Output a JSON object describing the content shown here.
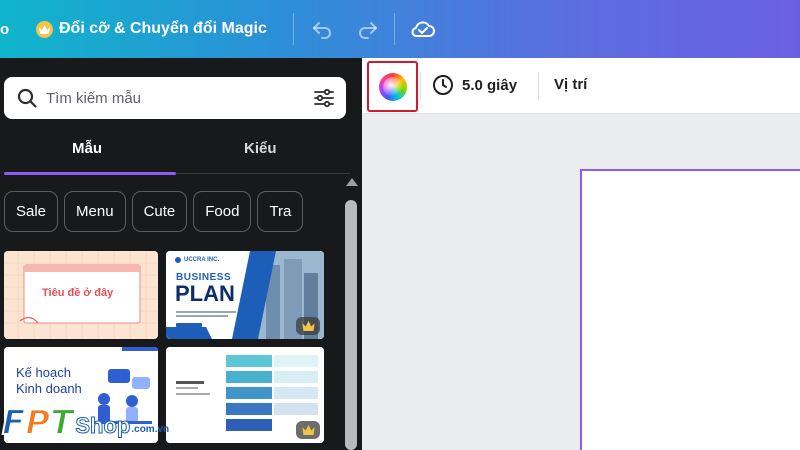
{
  "topbar": {
    "left_fragment": "o",
    "magic_label": "Đổi cỡ & Chuyển đổi Magic",
    "crown_icon": "crown-icon",
    "undo_icon": "undo-icon",
    "redo_icon": "redo-icon",
    "cloud_icon": "cloud-check-icon"
  },
  "panel": {
    "search": {
      "placeholder": "Tìm kiếm mẫu",
      "icon": "search-icon",
      "filter_icon": "sliders-icon"
    },
    "tabs": [
      {
        "label": "Mẫu",
        "active": true
      },
      {
        "label": "Kiểu",
        "active": false
      }
    ],
    "chips": [
      "Sale",
      "Menu",
      "Cute",
      "Food",
      "Tra"
    ],
    "templates": [
      {
        "text": "Tiêu đề ở đây"
      },
      {
        "brand": "UCCRA INC.",
        "line1": "BUSINESS",
        "line2": "PLAN",
        "pro": true
      },
      {
        "line1": "Kế hoạch",
        "line2": "Kinh doanh"
      },
      {
        "pro": true
      }
    ]
  },
  "toolbar": {
    "color_icon": "color-wheel-icon",
    "duration_icon": "clock-icon",
    "duration": "5.0 giây",
    "position": "Vị trí"
  },
  "colors": {
    "accent": "#8b5cf6",
    "highlight": "#d7182a",
    "panel_bg": "#18191b"
  },
  "watermark": {
    "brand": "FPT",
    "shop": "Shop",
    "domain": ".com.vn"
  }
}
